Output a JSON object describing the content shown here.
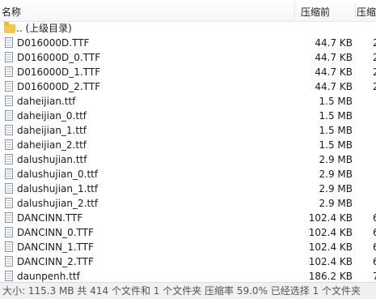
{
  "header": {
    "name_label": "名称",
    "packed_label": "压缩前",
    "original_label": "压缩"
  },
  "folder_row": {
    "name": ".. (上级目录)"
  },
  "files": [
    {
      "name": "D016000D.TTF",
      "packed": "44.7 KB",
      "original": "2"
    },
    {
      "name": "D016000D_0.TTF",
      "packed": "44.7 KB",
      "original": "2"
    },
    {
      "name": "D016000D_1.TTF",
      "packed": "44.7 KB",
      "original": "2"
    },
    {
      "name": "D016000D_2.TTF",
      "packed": "44.7 KB",
      "original": "2"
    },
    {
      "name": "daheijian.ttf",
      "packed": "1.5 MB",
      "original": ""
    },
    {
      "name": "daheijian_0.ttf",
      "packed": "1.5 MB",
      "original": ""
    },
    {
      "name": "daheijian_1.ttf",
      "packed": "1.5 MB",
      "original": ""
    },
    {
      "name": "daheijian_2.ttf",
      "packed": "1.5 MB",
      "original": ""
    },
    {
      "name": "dalushujian.ttf",
      "packed": "2.9 MB",
      "original": ""
    },
    {
      "name": "dalushujian_0.ttf",
      "packed": "2.9 MB",
      "original": ""
    },
    {
      "name": "dalushujian_1.ttf",
      "packed": "2.9 MB",
      "original": ""
    },
    {
      "name": "dalushujian_2.ttf",
      "packed": "2.9 MB",
      "original": ""
    },
    {
      "name": "DANCINN.TTF",
      "packed": "102.4 KB",
      "original": "6"
    },
    {
      "name": "DANCINN_0.TTF",
      "packed": "102.4 KB",
      "original": "6"
    },
    {
      "name": "DANCINN_1.TTF",
      "packed": "102.4 KB",
      "original": "6"
    },
    {
      "name": "DANCINN_2.TTF",
      "packed": "102.4 KB",
      "original": "6"
    },
    {
      "name": "daunpenh.ttf",
      "packed": "186.2 KB",
      "original": "7"
    }
  ],
  "status": "大小: 115.3 MB 共 414 个文件和 1 个文件夹 压缩率 59.0% 已经选择 1 个文件夹"
}
